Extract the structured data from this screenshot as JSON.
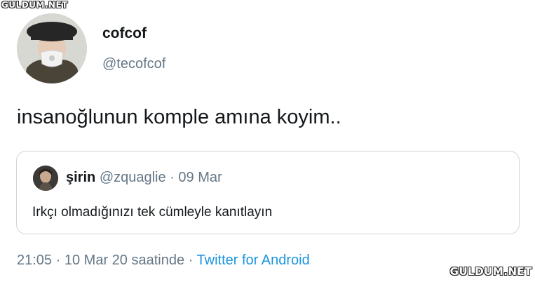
{
  "watermark": {
    "text": "GULDUM.NET"
  },
  "author": {
    "display_name": "cofcof",
    "handle": "@tecofcof"
  },
  "tweet": {
    "text": "insanoğlunun komple amına koyim.."
  },
  "quoted_tweet": {
    "display_name": "şirin",
    "handle": "@zquaglie",
    "separator": "·",
    "date": "09 Mar",
    "text": "Irkçı olmadığınızı tek cümleyle kanıtlayın"
  },
  "meta": {
    "time": "21:05",
    "separator": "·",
    "date": "10 Mar 20 saatinde",
    "separator2": "·",
    "source": "Twitter for Android"
  },
  "colors": {
    "text": "#14171a",
    "secondary": "#657786",
    "link": "#1b95e0",
    "border": "#ccd6dd"
  }
}
